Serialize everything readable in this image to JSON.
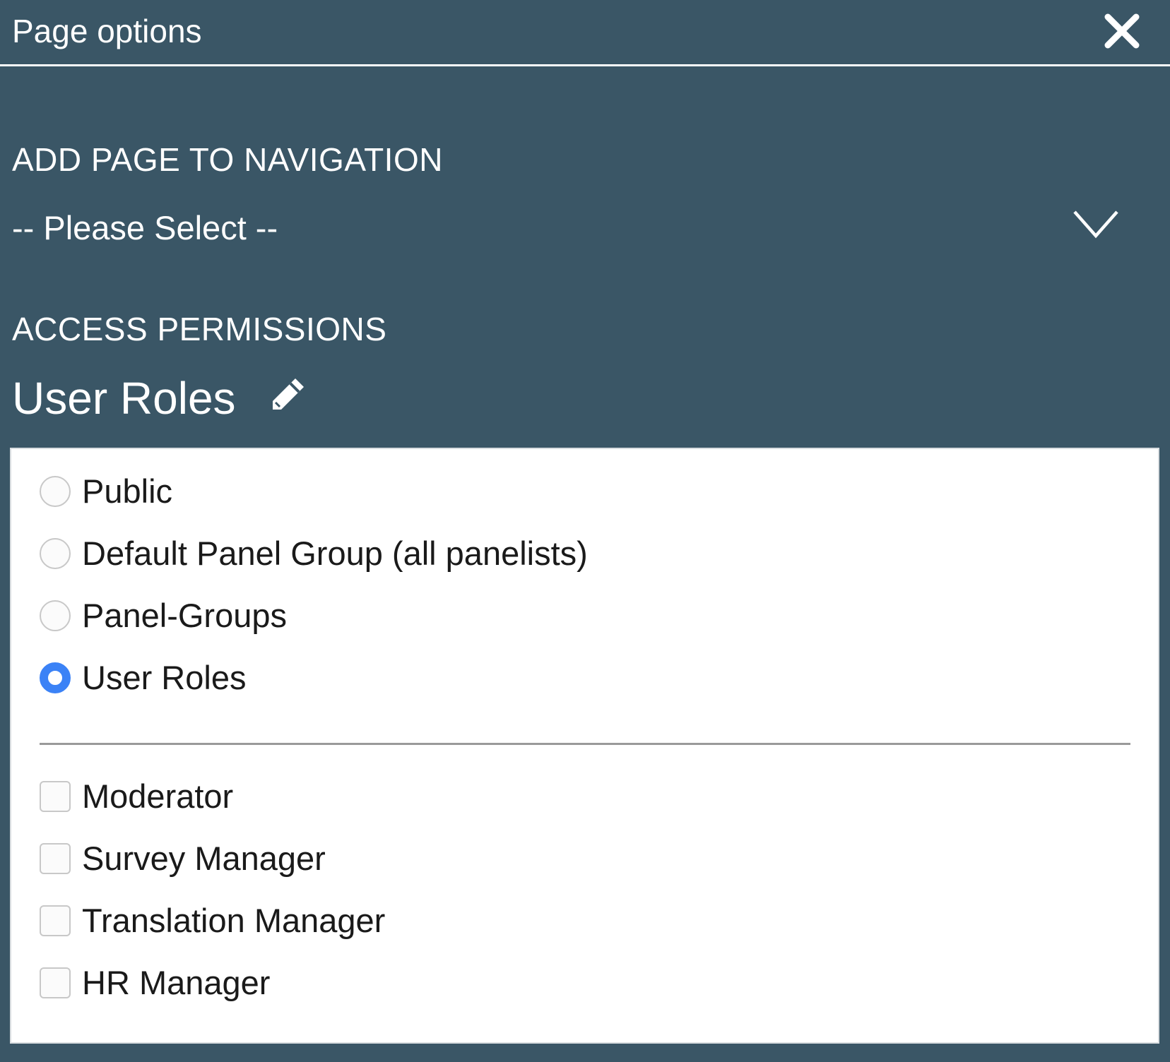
{
  "header": {
    "title": "Page options",
    "close_icon": "close-icon"
  },
  "navigation": {
    "label": "ADD PAGE TO NAVIGATION",
    "select_value": "-- Please Select --",
    "chevron_icon": "chevron-down-icon"
  },
  "permissions": {
    "label": "ACCESS PERMISSIONS",
    "current_title": "User Roles",
    "edit_icon": "pencil-icon",
    "access_options": [
      {
        "label": "Public",
        "checked": false
      },
      {
        "label": "Default Panel Group (all panelists)",
        "checked": false
      },
      {
        "label": "Panel-Groups",
        "checked": false
      },
      {
        "label": "User Roles",
        "checked": true
      }
    ],
    "roles": [
      {
        "label": "Moderator",
        "checked": false
      },
      {
        "label": "Survey Manager",
        "checked": false
      },
      {
        "label": "Translation Manager",
        "checked": false
      },
      {
        "label": "HR Manager",
        "checked": false
      }
    ]
  },
  "colors": {
    "background": "#3a5666",
    "panel": "#ffffff",
    "accent": "#3b82f6"
  }
}
